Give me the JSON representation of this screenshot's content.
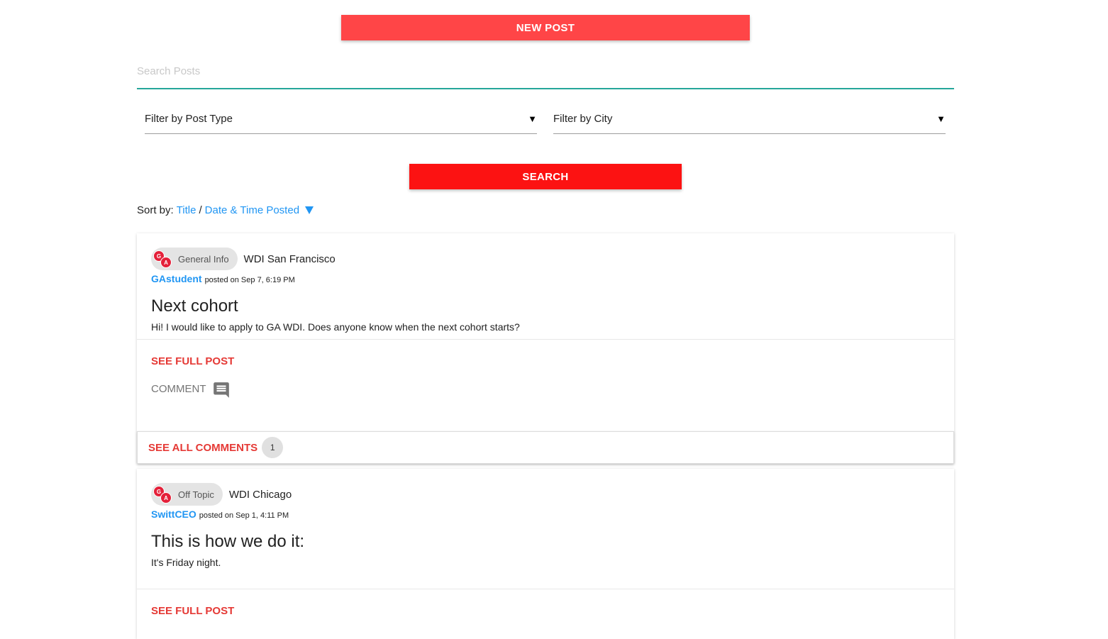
{
  "header": {
    "new_post_label": "NEW POST",
    "search_placeholder": "Search Posts",
    "search_value": "",
    "filter_type_label": "Filter by Post Type",
    "filter_city_label": "Filter by City",
    "search_button_label": "SEARCH"
  },
  "sort": {
    "prefix": "Sort by:",
    "title_option": "Title",
    "separator": "/",
    "date_option": "Date & Time Posted"
  },
  "posts": [
    {
      "type": "General Info",
      "city": "WDI San Francisco",
      "author": "GAstudent",
      "posted": "posted on Sep 7, 6:19 PM",
      "title": "Next cohort",
      "body": "Hi! I would like to apply to GA WDI. Does anyone know when the next cohort starts?",
      "see_full_label": "SEE FULL POST",
      "comment_label": "COMMENT",
      "see_all_comments_label": "SEE ALL COMMENTS",
      "comment_count": "1"
    },
    {
      "type": "Off Topic",
      "city": "WDI Chicago",
      "author": "SwittCEO",
      "posted": "posted on Sep 1, 4:11 PM",
      "title": "This is how we do it:",
      "body": "It's Friday night.",
      "see_full_label": "SEE FULL POST"
    }
  ],
  "logo": {
    "letters": [
      "G",
      "A"
    ]
  },
  "colors": {
    "new_post_bg": "#ff4547",
    "search_btn_bg": "#fc1212",
    "link_blue": "#2196f3",
    "action_red": "#e53935",
    "input_underline": "#26a69a"
  }
}
